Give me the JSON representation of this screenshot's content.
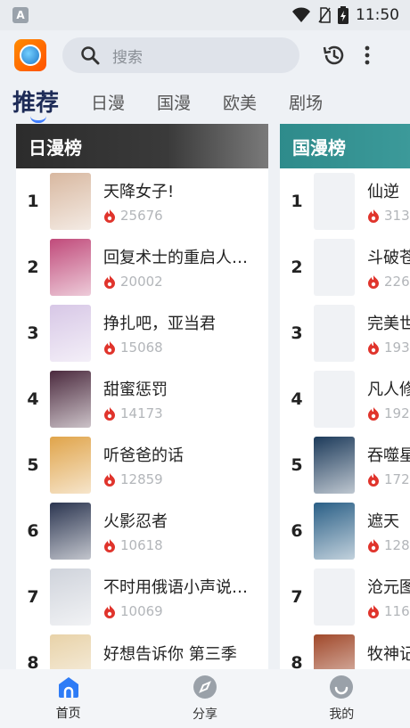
{
  "status": {
    "time": "11:50"
  },
  "appbar": {
    "search_placeholder": "搜索"
  },
  "tabs": [
    "推荐",
    "日漫",
    "国漫",
    "欧美",
    "剧场"
  ],
  "left_list": {
    "title": "日漫榜",
    "items": [
      {
        "rank": "1",
        "title": "天降女子!",
        "heat": "25676",
        "cover": "#d8b8a0"
      },
      {
        "rank": "2",
        "title": "回复术士的重启人…",
        "heat": "20002",
        "cover": "#c04a7a"
      },
      {
        "rank": "3",
        "title": "挣扎吧，亚当君",
        "heat": "15068",
        "cover": "#d7c7e6"
      },
      {
        "rank": "4",
        "title": "甜蜜惩罚",
        "heat": "14173",
        "cover": "#4b2a3e"
      },
      {
        "rank": "5",
        "title": "听爸爸的话",
        "heat": "12859",
        "cover": "#e0a44a"
      },
      {
        "rank": "6",
        "title": "火影忍者",
        "heat": "10618",
        "cover": "#2b3550"
      },
      {
        "rank": "7",
        "title": "不时用俄语小声说…",
        "heat": "10069",
        "cover": "#cfd3db"
      },
      {
        "rank": "8",
        "title": "好想告诉你 第三季",
        "heat": "",
        "cover": "#e8d2a8"
      }
    ]
  },
  "right_list": {
    "title": "国漫榜",
    "items": [
      {
        "rank": "1",
        "title": "仙逆",
        "heat": "313",
        "cover": ""
      },
      {
        "rank": "2",
        "title": "斗破苍",
        "heat": "226",
        "cover": ""
      },
      {
        "rank": "3",
        "title": "完美世",
        "heat": "193",
        "cover": ""
      },
      {
        "rank": "4",
        "title": "凡人修",
        "heat": "192",
        "cover": ""
      },
      {
        "rank": "5",
        "title": "吞噬星",
        "heat": "172",
        "cover": "#1c3a5a"
      },
      {
        "rank": "6",
        "title": "遮天",
        "heat": "128",
        "cover": "#2a5f86"
      },
      {
        "rank": "7",
        "title": "沧元图",
        "heat": "116",
        "cover": ""
      },
      {
        "rank": "8",
        "title": "牧神记",
        "heat": "",
        "cover": "#a0482a"
      }
    ]
  },
  "bottom_nav": [
    {
      "label": "首页",
      "icon": "home-icon"
    },
    {
      "label": "分享",
      "icon": "compass-icon"
    },
    {
      "label": "我的",
      "icon": "profile-icon"
    }
  ],
  "colors": {
    "accent": "#2e7cf6",
    "heat": "#e0342c",
    "left_header": "#2c2c2c",
    "right_header": "#2e8b8b"
  }
}
